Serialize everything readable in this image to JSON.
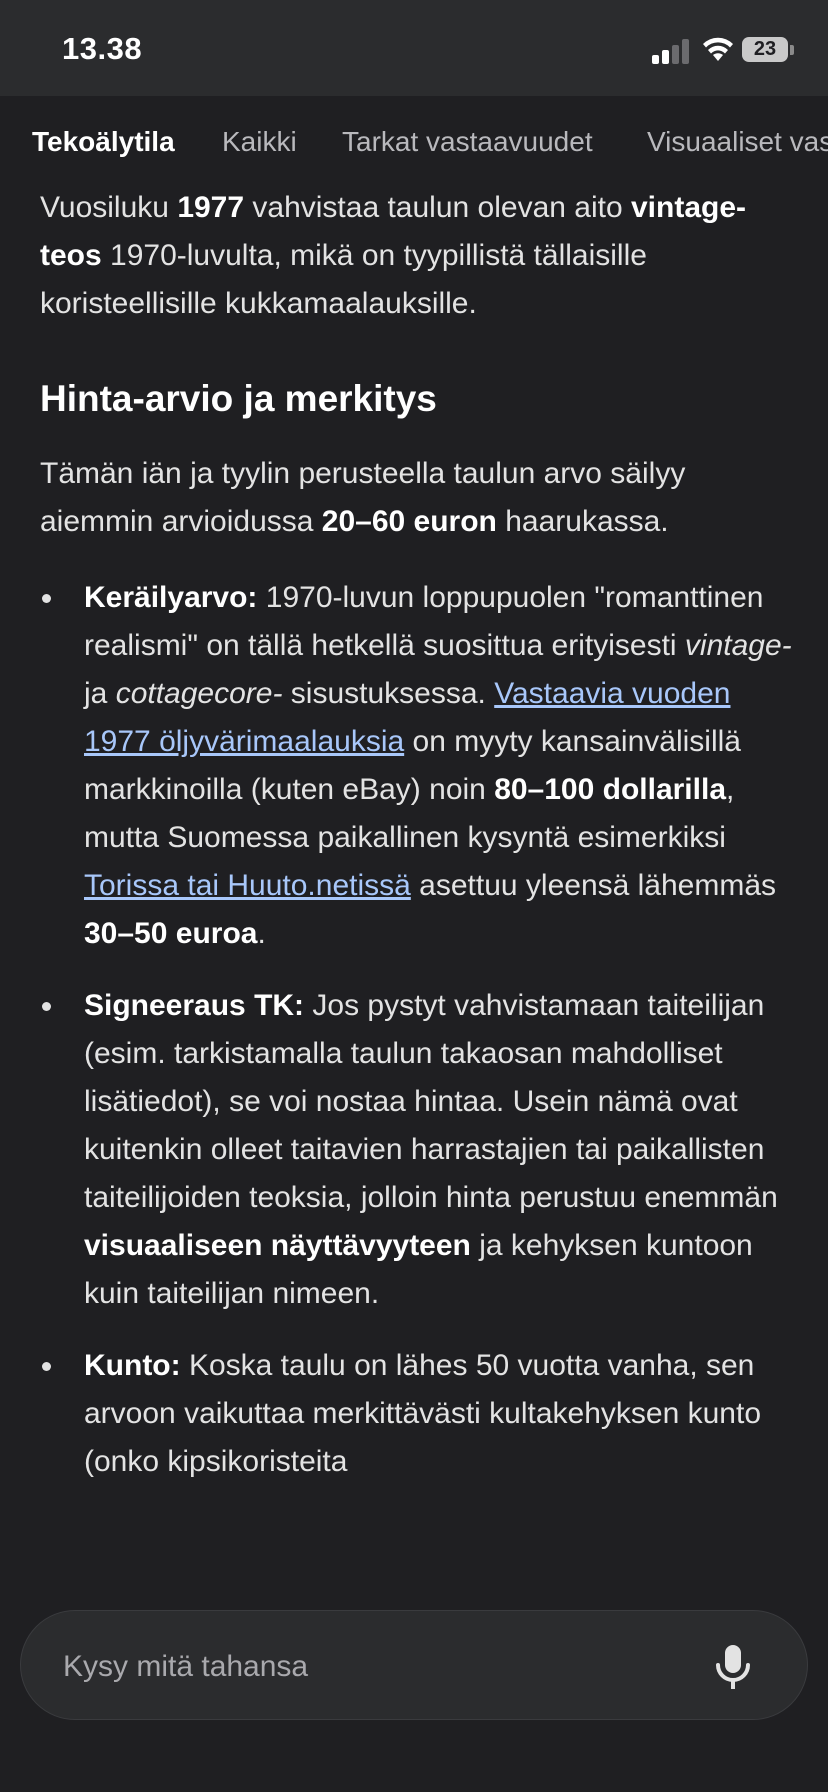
{
  "status_bar": {
    "time": "13.38",
    "battery": "23"
  },
  "tabs": [
    {
      "label": "Tekoälytila",
      "active": true
    },
    {
      "label": "Kaikki",
      "active": false
    },
    {
      "label": "Tarkat vastaavuudet",
      "active": false
    },
    {
      "label": "Visuaaliset vas",
      "active": false
    }
  ],
  "intro": {
    "t1": "Vuosiluku ",
    "b1": "1977",
    "t2": " vahvistaa taulun olevan aito ",
    "b2": "vintage-teos",
    "t3": " 1970-luvulta, mikä on tyypillistä tällaisille koristeellisille kukkamaalauksille."
  },
  "section_heading": "Hinta-arvio ja merkitys",
  "summary": {
    "t1": "Tämän iän ja tyylin perusteella taulun arvo säilyy aiemmin arvioidussa ",
    "b1": "20–60 euron",
    "t2": " haarukassa."
  },
  "bullets": {
    "collect": {
      "label": "Keräilyarvo:",
      "t1": " 1970-luvun loppupuolen \"romanttinen realismi\" on tällä hetkellä suosittua erityisesti ",
      "i1": "vintage-",
      "t2": " ja ",
      "i2": "cottagecore-",
      "t3": " sisustuksessa. ",
      "link1": "Vastaavia vuoden 1977 öljyvärimaalauksia",
      "t4": " on myyty kansainvälisillä markkinoilla (kuten eBay) noin ",
      "b1": "80–100 dollarilla",
      "t5": ", mutta Suomessa paikallinen kysyntä esimerkiksi ",
      "link2": "Torissa tai Huuto.netissä",
      "t6": " asettuu yleensä lähemmäs ",
      "b2": "30–50 euroa",
      "t7": "."
    },
    "sign": {
      "label": "Signeeraus TK:",
      "t1": " Jos pystyt vahvistamaan taiteilijan (esim. tarkistamalla taulun takaosan mahdolliset lisätiedot), se voi nostaa hintaa. Usein nämä ovat kuitenkin olleet taitavien harrastajien tai paikallisten taiteilijoiden teoksia, jolloin hinta perustuu enemmän ",
      "b1": "visuaaliseen näyttävyyteen",
      "t2": " ja kehyksen kuntoon kuin taiteilijan nimeen."
    },
    "condition": {
      "label": "Kunto:",
      "t1": " Koska taulu on lähes 50 vuotta vanha, sen arvoon vaikuttaa merkittävästi kultakehyksen kunto (onko kipsikoristeita"
    }
  },
  "ask": {
    "placeholder": "Kysy mitä tahansa"
  },
  "icons": {
    "signal": "cellular-signal-icon",
    "wifi": "wifi-icon",
    "battery": "battery-icon",
    "mic": "microphone-icon"
  },
  "colors": {
    "background": "#1f1f22",
    "link": "#a8c7fa",
    "text": "#e3e3e3"
  }
}
